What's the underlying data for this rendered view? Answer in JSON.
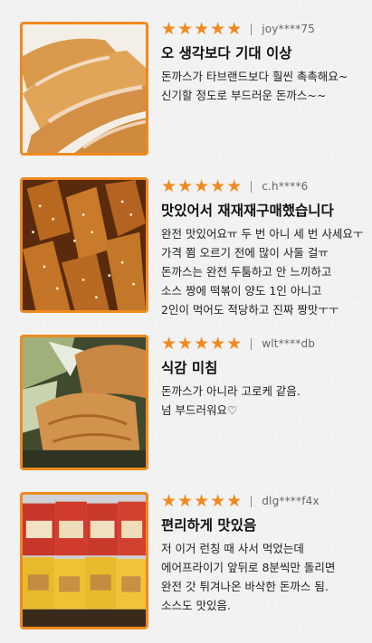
{
  "accent_color": "#ef8a1f",
  "star_glyph": "★",
  "reviews": [
    {
      "image": "fried-pork-cutlet-photo",
      "stars": 5,
      "user": "joy****75",
      "title": "오 생각보다 기대 이상",
      "lines": [
        "돈까스가 타브랜드보다 훨씬 촉촉해요~",
        "신기할 정도로 부드러운 돈까스~~"
      ]
    },
    {
      "image": "sesame-sauced-cutlet-photo",
      "stars": 5,
      "user": "c.h****6",
      "title": "맛있어서 재재재구매했습니다",
      "lines": [
        "완전 맛있어요ㅠ 두 번 아니 세 번 사세요ㅜ",
        "가격 쬠 오르기 전에 많이 사둘 걸ㅠ",
        "돈까스는 완전 두툼하고 안 느끼하고",
        "소스 짱에 떡볶이 양도 1인 아니고",
        "2인이 먹어도 적당하고 진짜 짱맛ㅜㅜ"
      ]
    },
    {
      "image": "cutlet-with-salad-photo",
      "stars": 5,
      "user": "wlt****db",
      "title": "식감 미침",
      "lines": [
        "돈까스가 아니라 고로케 같음.",
        "넘 부드러워요♡"
      ]
    },
    {
      "image": "packaged-products-photo",
      "stars": 5,
      "user": "dlg****f4x",
      "title": "편리하게 맛있음",
      "lines": [
        "저 이거 런칭 때 사서 먹었는데",
        "에어프라이기 앞뒤로 8분씩만 돌리면",
        "완전 갓 튀겨나온 바삭한 돈까스 됨.",
        "소스도 맛있음."
      ]
    }
  ]
}
